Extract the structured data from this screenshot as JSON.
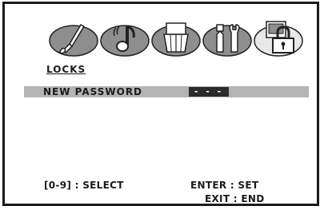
{
  "menu": {
    "tabs": [
      {
        "id": "picture",
        "icon": "paintbrush-icon",
        "active": false
      },
      {
        "id": "audio",
        "icon": "music-note-icon",
        "active": false
      },
      {
        "id": "channel",
        "icon": "tv-icon",
        "active": false
      },
      {
        "id": "setup",
        "icon": "tools-icon",
        "active": false
      },
      {
        "id": "locks",
        "icon": "lock-icon",
        "active": true
      }
    ]
  },
  "section": {
    "title": "LOCKS"
  },
  "password": {
    "label": "NEW PASSWORD",
    "value": "- - - -"
  },
  "footer": {
    "select_hint": "[0-9] : SELECT",
    "enter_hint": "ENTER : SET",
    "exit_hint": "EXIT : END"
  },
  "colors": {
    "tab_fill": "#8e8e8e",
    "tab_active_fill": "#e8e8e8",
    "highlight_row": "#b4b4b4",
    "value_box": "#2b2b2b",
    "text": "#1a1a1a"
  }
}
